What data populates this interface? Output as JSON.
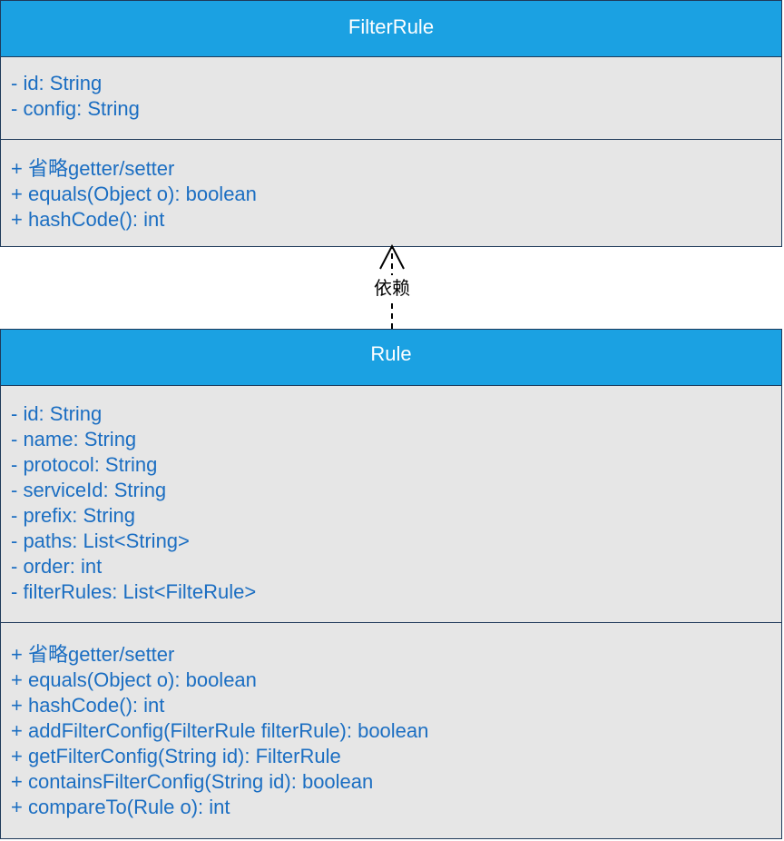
{
  "filter_rule_class": {
    "name": "FilterRule",
    "attributes": [
      "- id: String",
      "- config: String"
    ],
    "methods": [
      "+ 省略getter/setter",
      "+ equals(Object o): boolean",
      "+ hashCode(): int"
    ]
  },
  "dependency": {
    "label": "依赖",
    "from": "Rule",
    "to": "FilterRule",
    "style": "dashed-open-arrow"
  },
  "rule_class": {
    "name": "Rule",
    "attributes": [
      "- id: String",
      "- name: String",
      "- protocol: String",
      "- serviceId: String",
      "- prefix: String",
      "- paths: List<String>",
      "- order: int",
      "- filterRules: List<FilteRule>"
    ],
    "methods": [
      "+ 省略getter/setter",
      "+ equals(Object o): boolean",
      "+ hashCode(): int",
      "+ addFilterConfig(FilterRule filterRule): boolean",
      "+ getFilterConfig(String id): FilterRule",
      "+ containsFilterConfig(String id): boolean",
      "+ compareTo(Rule o): int"
    ]
  },
  "colors": {
    "header_fill": "#1ba1e2",
    "body_fill": "#e6e6e6",
    "border": "#1f3a5a",
    "member_text": "#1b6ec2",
    "header_text": "#ffffff"
  }
}
